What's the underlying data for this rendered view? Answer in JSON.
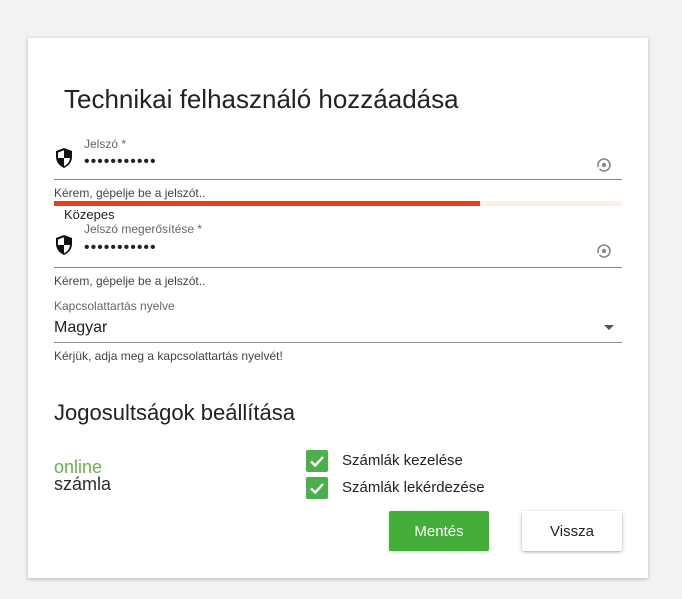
{
  "form": {
    "title": "Technikai felhasználó hozzáadása",
    "password": {
      "label": "Jelszó *",
      "value": "•••••••••••",
      "helper": "Kérem, gépelje be a jelszót.."
    },
    "strength": {
      "label": "Közepes",
      "level": 0.75,
      "color": "#e0401b"
    },
    "password_confirm": {
      "label": "Jelszó megerősítése *",
      "value": "•••••••••••",
      "helper": "Kérem, gépelje be a jelszót.."
    },
    "language": {
      "label": "Kapcsolattartás nyelve",
      "value": "Magyar",
      "helper": "Kérjük, adja meg a kapcsolattartás nyelvét!"
    }
  },
  "permissions": {
    "title": "Jogosultságok beállítása",
    "logo": {
      "line1": "online",
      "line2": "számla"
    },
    "items": [
      {
        "label": "Számlák kezelése",
        "checked": true
      },
      {
        "label": "Számlák lekérdezése",
        "checked": true
      }
    ]
  },
  "actions": {
    "save_label": "Mentés",
    "back_label": "Vissza"
  },
  "colors": {
    "accent_green": "#45ad3a",
    "strength_red": "#e0401b"
  }
}
